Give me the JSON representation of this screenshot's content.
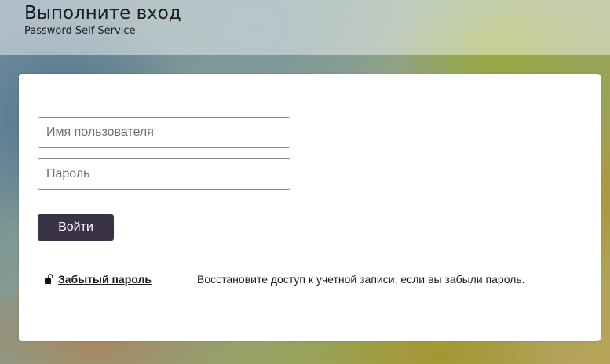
{
  "header": {
    "title": "Выполните вход",
    "subtitle": "Password Self Service"
  },
  "login_form": {
    "username_placeholder": "Имя пользователя",
    "username_value": "",
    "password_placeholder": "Пароль",
    "password_value": "",
    "submit_label": "Войти"
  },
  "forgot_password": {
    "icon": "unlock-icon",
    "link_label": "Забытый пароль",
    "description": "Восстановите доступ к учетной записи, если вы забыли пароль."
  },
  "colors": {
    "button_bg": "#3a3247",
    "card_bg": "#ffffff"
  }
}
